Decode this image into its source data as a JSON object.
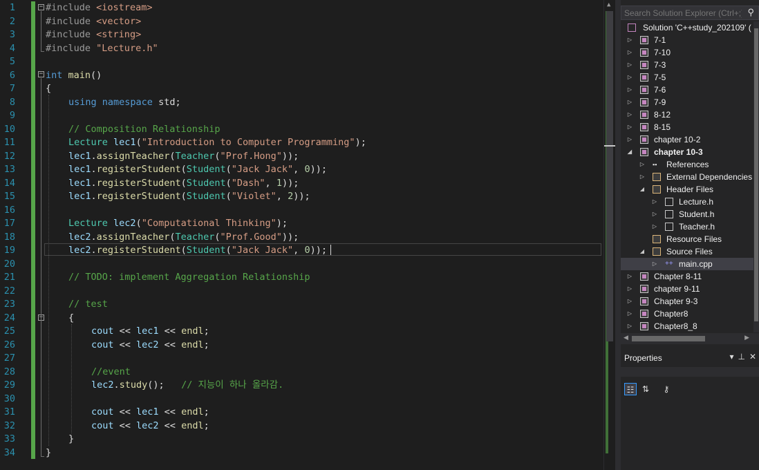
{
  "editor": {
    "lines": [
      {
        "n": "1"
      },
      {
        "n": "2"
      },
      {
        "n": "3"
      },
      {
        "n": "4"
      },
      {
        "n": "5"
      },
      {
        "n": "6"
      },
      {
        "n": "7"
      },
      {
        "n": "8"
      },
      {
        "n": "9"
      },
      {
        "n": "10"
      },
      {
        "n": "11"
      },
      {
        "n": "12"
      },
      {
        "n": "13"
      },
      {
        "n": "14"
      },
      {
        "n": "15"
      },
      {
        "n": "16"
      },
      {
        "n": "17"
      },
      {
        "n": "18"
      },
      {
        "n": "19"
      },
      {
        "n": "20"
      },
      {
        "n": "21"
      },
      {
        "n": "22"
      },
      {
        "n": "23"
      },
      {
        "n": "24"
      },
      {
        "n": "25"
      },
      {
        "n": "26"
      },
      {
        "n": "27"
      },
      {
        "n": "28"
      },
      {
        "n": "29"
      },
      {
        "n": "30"
      },
      {
        "n": "31"
      },
      {
        "n": "32"
      },
      {
        "n": "33"
      },
      {
        "n": "34"
      }
    ],
    "tokens": {
      "l1": [
        "#include",
        "<iostream>"
      ],
      "l2": [
        "#include",
        "<vector>"
      ],
      "l3": [
        "#include",
        "<string>"
      ],
      "l4": [
        "#include",
        "\"Lecture.h\""
      ],
      "l6": [
        "int",
        "main",
        "()"
      ],
      "l7": "{",
      "l8": [
        "using",
        "namespace",
        "std;"
      ],
      "l10": "// Composition Relationship",
      "l11": [
        "Lecture",
        "lec1",
        "(",
        "\"Introduction to Computer Programming\"",
        ");"
      ],
      "l12": [
        "lec1",
        ".",
        "assignTeacher",
        "(",
        "Teacher",
        "(",
        "\"Prof.Hong\"",
        "));"
      ],
      "l13": [
        "lec1",
        ".",
        "registerStudent",
        "(",
        "Student",
        "(",
        "\"Jack Jack\"",
        ", ",
        "0",
        "));"
      ],
      "l14": [
        "lec1",
        ".",
        "registerStudent",
        "(",
        "Student",
        "(",
        "\"Dash\"",
        ", ",
        "1",
        "));"
      ],
      "l15": [
        "lec1",
        ".",
        "registerStudent",
        "(",
        "Student",
        "(",
        "\"Violet\"",
        ", ",
        "2",
        "));"
      ],
      "l17": [
        "Lecture",
        "lec2",
        "(",
        "\"Computational Thinking\"",
        ");"
      ],
      "l18": [
        "lec2",
        ".",
        "assignTeacher",
        "(",
        "Teacher",
        "(",
        "\"Prof.Good\"",
        "));"
      ],
      "l19": [
        "lec2",
        ".",
        "registerStudent",
        "(",
        "Student",
        "(",
        "\"Jack Jack\"",
        ", ",
        "0",
        "));"
      ],
      "l21": "// TODO: implement Aggregation Relationship",
      "l23": "// test",
      "l24": "{",
      "l25": [
        "cout",
        " << ",
        "lec1",
        " << ",
        "endl",
        ";"
      ],
      "l26": [
        "cout",
        " << ",
        "lec2",
        " << ",
        "endl",
        ";"
      ],
      "l28": "//event",
      "l29": [
        "lec2",
        ".",
        "study",
        "();",
        "   ",
        "// 지능이 하나 올라감."
      ],
      "l31": [
        "cout",
        " << ",
        "lec1",
        " << ",
        "endl",
        ";"
      ],
      "l32": [
        "cout",
        " << ",
        "lec2",
        " << ",
        "endl",
        ";"
      ],
      "l33": "}",
      "l34": "}"
    }
  },
  "solution_explorer": {
    "search_placeholder": "Search Solution Explorer (Ctrl+;)",
    "solution_label": "Solution 'C++study_202109' (",
    "items": [
      {
        "label": "7-1"
      },
      {
        "label": "7-10"
      },
      {
        "label": "7-3"
      },
      {
        "label": "7-5"
      },
      {
        "label": "7-6"
      },
      {
        "label": "7-9"
      },
      {
        "label": "8-12"
      },
      {
        "label": "8-15"
      },
      {
        "label": "chapter 10-2"
      },
      {
        "label": "chapter 10-3"
      },
      {
        "label": "References"
      },
      {
        "label": "External Dependencies"
      },
      {
        "label": "Header Files"
      },
      {
        "label": "Lecture.h"
      },
      {
        "label": "Student.h"
      },
      {
        "label": "Teacher.h"
      },
      {
        "label": "Resource Files"
      },
      {
        "label": "Source Files"
      },
      {
        "label": "main.cpp"
      },
      {
        "label": "Chapter 8-11"
      },
      {
        "label": "chapter 9-11"
      },
      {
        "label": "Chapter 9-3"
      },
      {
        "label": "Chapter8"
      },
      {
        "label": "Chapter8_8"
      }
    ]
  },
  "properties": {
    "title": "Properties"
  },
  "colors": {
    "keyword": "#569cd6",
    "type": "#4ec9b0",
    "function": "#dcdcaa",
    "string": "#d69d85",
    "comment": "#57a64a",
    "variable": "#9cdcfe",
    "number": "#b5cea8",
    "line_number": "#2b91af"
  }
}
